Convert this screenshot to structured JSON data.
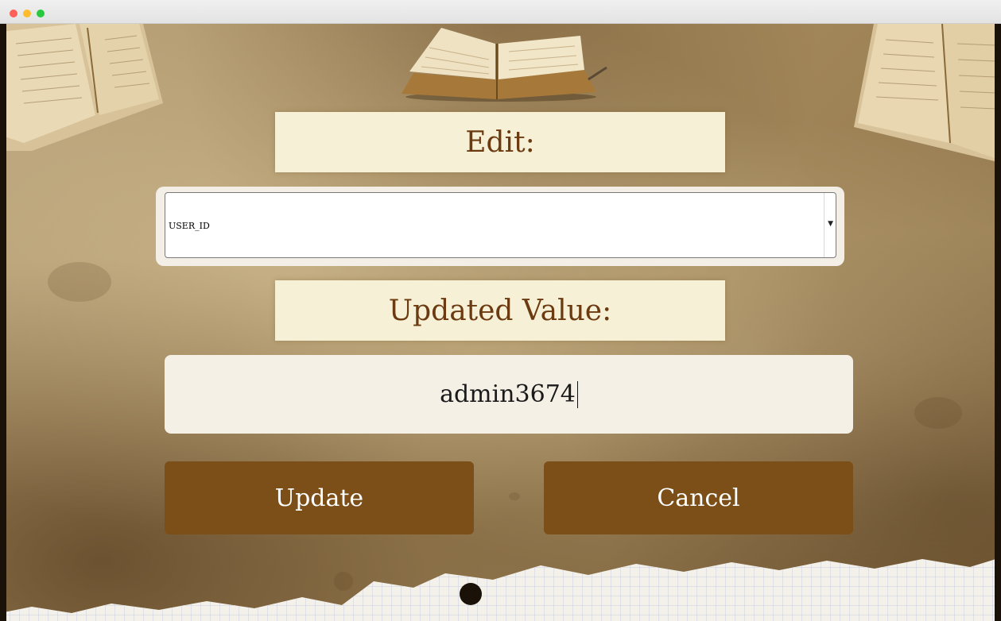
{
  "window": {
    "controls": [
      "close",
      "minimize",
      "maximize"
    ]
  },
  "form": {
    "edit_label": "Edit:",
    "field_select": {
      "selected": "USER_ID"
    },
    "updated_value_label": "Updated Value:",
    "updated_value_input": "admin3674",
    "update_button": "Update",
    "cancel_button": "Cancel"
  },
  "colors": {
    "label_band": "#f6f1d6",
    "label_text": "#6b3a10",
    "button_bg": "#7d4f18",
    "button_text": "#ffffff",
    "input_bg": "#f5f0e6",
    "parchment": "#a88d60"
  }
}
